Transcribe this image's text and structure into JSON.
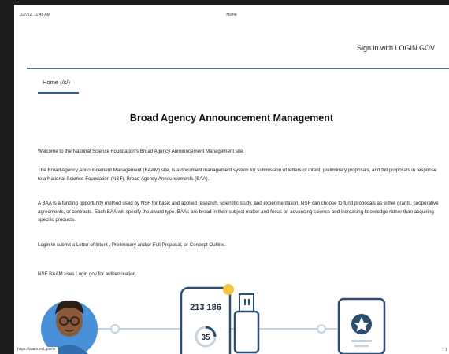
{
  "print_header": {
    "datetime": "11/7/22, 11:48 AM",
    "page_title": "Home"
  },
  "header": {
    "signin_label": "Sign in with LOGIN.GOV"
  },
  "nav": {
    "home_label": "Home (/s/)"
  },
  "main": {
    "title": "Broad Agency Announcement Management",
    "paragraphs": [
      "Welcome to the National Science Foundation's Broad Agency Announcement Management site.",
      "The Broad Agency Announcement Management (BAAM) site, is a document management system for submission of letters of intent, preliminary proposals, and full proposals in response to a National Science Foundation (NSF), Broad Agency Announcements (BAA).",
      "A BAA is a funding opportunity method used by NSF for basic and applied research, scientific study, and experimentation. NSF can choose to fund proposals as either grants, cooperative agreements, or contracts. Each BAA will specify the award type. BAAs are broad in their subject matter and focus on advancing science and increasing knowledge rather than acquiring specific products.",
      "Login to submit a Letter of Intent , Preliminary and/or Full Proposal, or Concept Outline.",
      "NSF BAAM uses Login.gov for authentication."
    ]
  },
  "illustration": {
    "phone_code": "213 186",
    "timer": "35",
    "icons": [
      "person-avatar-icon",
      "phone-code-icon",
      "usb-key-icon",
      "badge-card-icon"
    ],
    "colors": {
      "line": "#c5d3de",
      "phone_border": "#2b4f73",
      "dot": "#f5c542",
      "skin": "#8a5a3b",
      "shirt": "#2f6fb0",
      "avatar_bg": "#4a90d9"
    }
  },
  "footer": {
    "url": "https://baam.nsf.gov/s/",
    "page_number": "1"
  }
}
